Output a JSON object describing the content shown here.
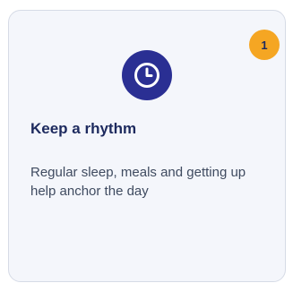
{
  "card": {
    "badge_number": "1",
    "icon": "clock-icon",
    "title": "Keep a rhythm",
    "description": "Regular sleep, meals and getting up help anchor the day"
  },
  "colors": {
    "card_background": "#f4f6fb",
    "card_border": "#d6dbe6",
    "badge_background": "#f5a623",
    "icon_background": "#2a2f93",
    "title_color": "#1d2a5e",
    "text_color": "#3f4b60"
  }
}
